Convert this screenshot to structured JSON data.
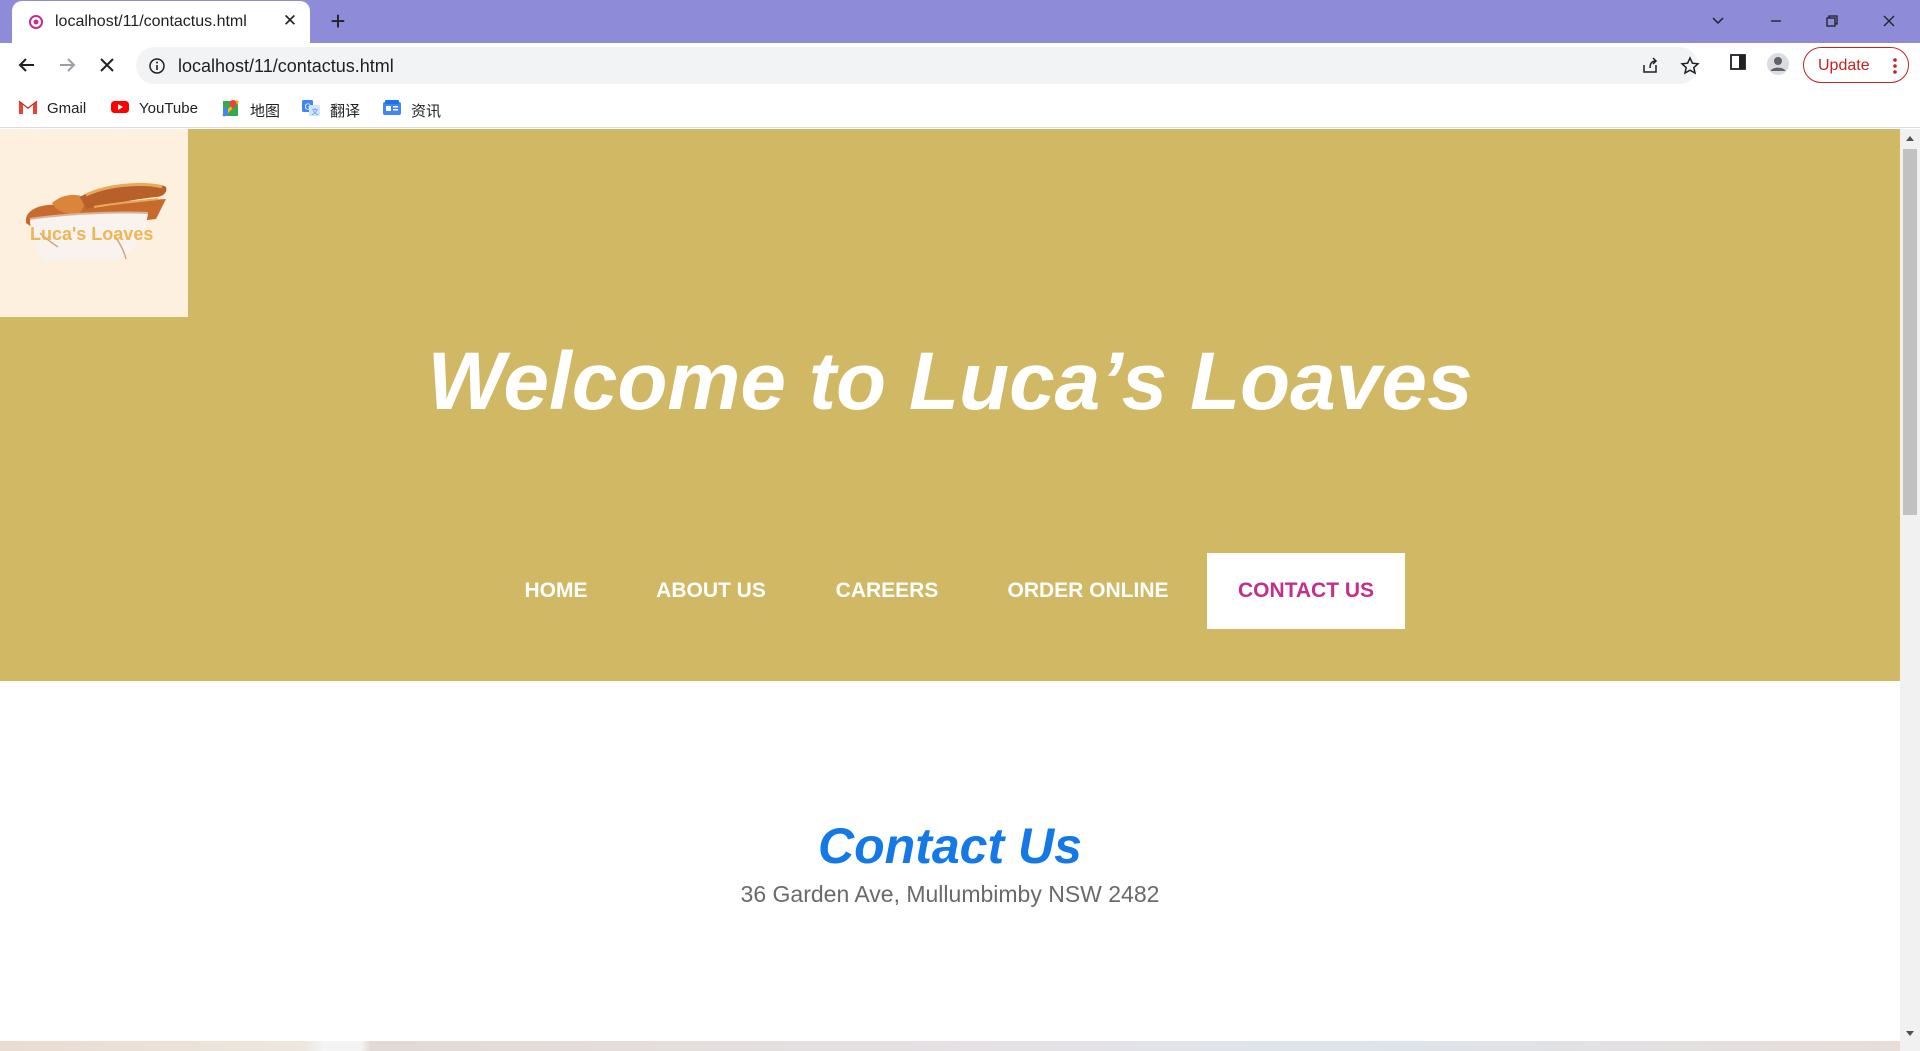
{
  "browser": {
    "tab": {
      "title": "localhost/11/contactus.html"
    },
    "address": {
      "url": "localhost/11/contactus.html"
    },
    "update_label": "Update",
    "bookmarks": [
      {
        "label": "Gmail",
        "icon": "gmail-icon"
      },
      {
        "label": "YouTube",
        "icon": "youtube-icon"
      },
      {
        "label": "地图",
        "icon": "maps-icon"
      },
      {
        "label": "翻译",
        "icon": "translate-icon"
      },
      {
        "label": "资讯",
        "icon": "news-icon"
      }
    ],
    "colors": {
      "tabbar": "#8e8bd9",
      "update": "#c5221f"
    }
  },
  "page": {
    "logo_text": "Luca's Loaves",
    "hero_title": "Welcome to Luca’s Loaves",
    "nav": [
      {
        "label": "HOME",
        "active": false
      },
      {
        "label": "ABOUT US",
        "active": false
      },
      {
        "label": "CAREERS",
        "active": false
      },
      {
        "label": "ORDER ONLINE",
        "active": false
      },
      {
        "label": "CONTACT US",
        "active": true
      }
    ],
    "contact": {
      "title": "Contact Us",
      "address": "36 Garden Ave, Mullumbimby NSW 2482"
    },
    "colors": {
      "header_bg": "#d0b864",
      "logo_bg": "#fdf0df",
      "active_nav_text": "#c2308b",
      "contact_title": "#1478e6"
    }
  }
}
